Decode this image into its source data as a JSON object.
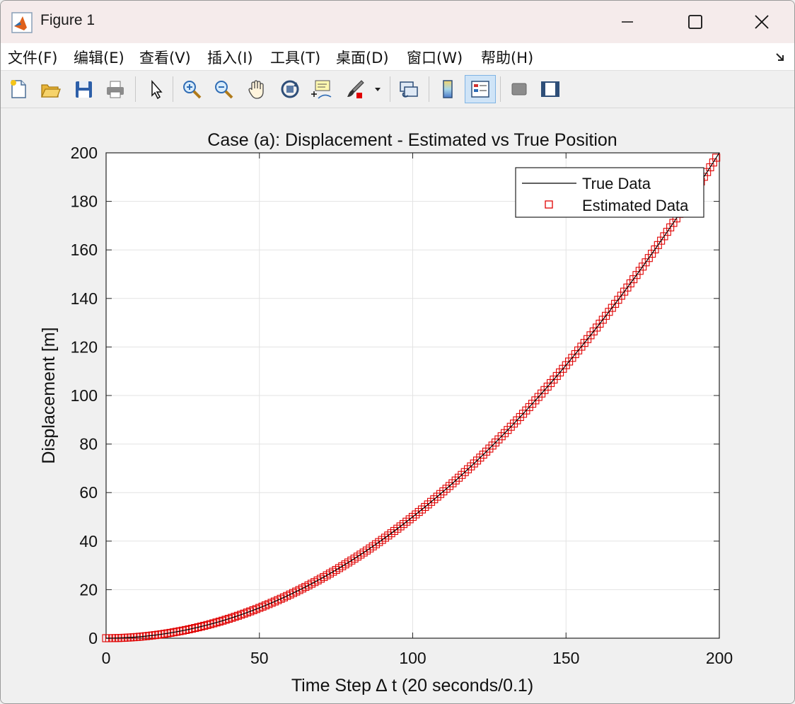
{
  "window": {
    "title": "Figure 1"
  },
  "menubar": {
    "items": [
      "文件(F)",
      "编辑(E)",
      "查看(V)",
      "插入(I)",
      "工具(T)",
      "桌面(D)",
      "窗口(W)",
      "帮助(H)"
    ]
  },
  "toolbar": {
    "buttons": [
      "new-figure-icon",
      "open-file-icon",
      "save-icon",
      "print-icon",
      "pointer-icon",
      "zoom-in-icon",
      "zoom-out-icon",
      "pan-icon",
      "rotate-3d-icon",
      "data-cursor-icon",
      "brush-icon",
      "link-plot-icon",
      "colorbar-icon",
      "legend-icon",
      "hide-plot-tools-icon",
      "show-plot-tools-icon"
    ]
  },
  "chart_data": {
    "type": "line",
    "title": "Case (a): Displacement - Estimated vs True Position",
    "xlabel": "Time Step ∆ t (20 seconds/0.1)",
    "ylabel": "Displacement [m]",
    "xlim": [
      0,
      200
    ],
    "ylim": [
      0,
      200
    ],
    "xticks": [
      0,
      50,
      100,
      150,
      200
    ],
    "yticks": [
      0,
      20,
      40,
      60,
      80,
      100,
      120,
      140,
      160,
      180,
      200
    ],
    "grid": true,
    "legend_position": "top-right",
    "series": [
      {
        "name": "True Data",
        "style": "solid-line",
        "color": "#000000",
        "model": "y = 0.005 * x^2",
        "x_range": [
          0,
          200
        ]
      },
      {
        "name": "Estimated Data",
        "style": "square-markers",
        "color": "#e00000",
        "model": "y = 0.005 * x^2",
        "x_range": [
          0,
          199
        ],
        "x_step": 1
      }
    ]
  }
}
